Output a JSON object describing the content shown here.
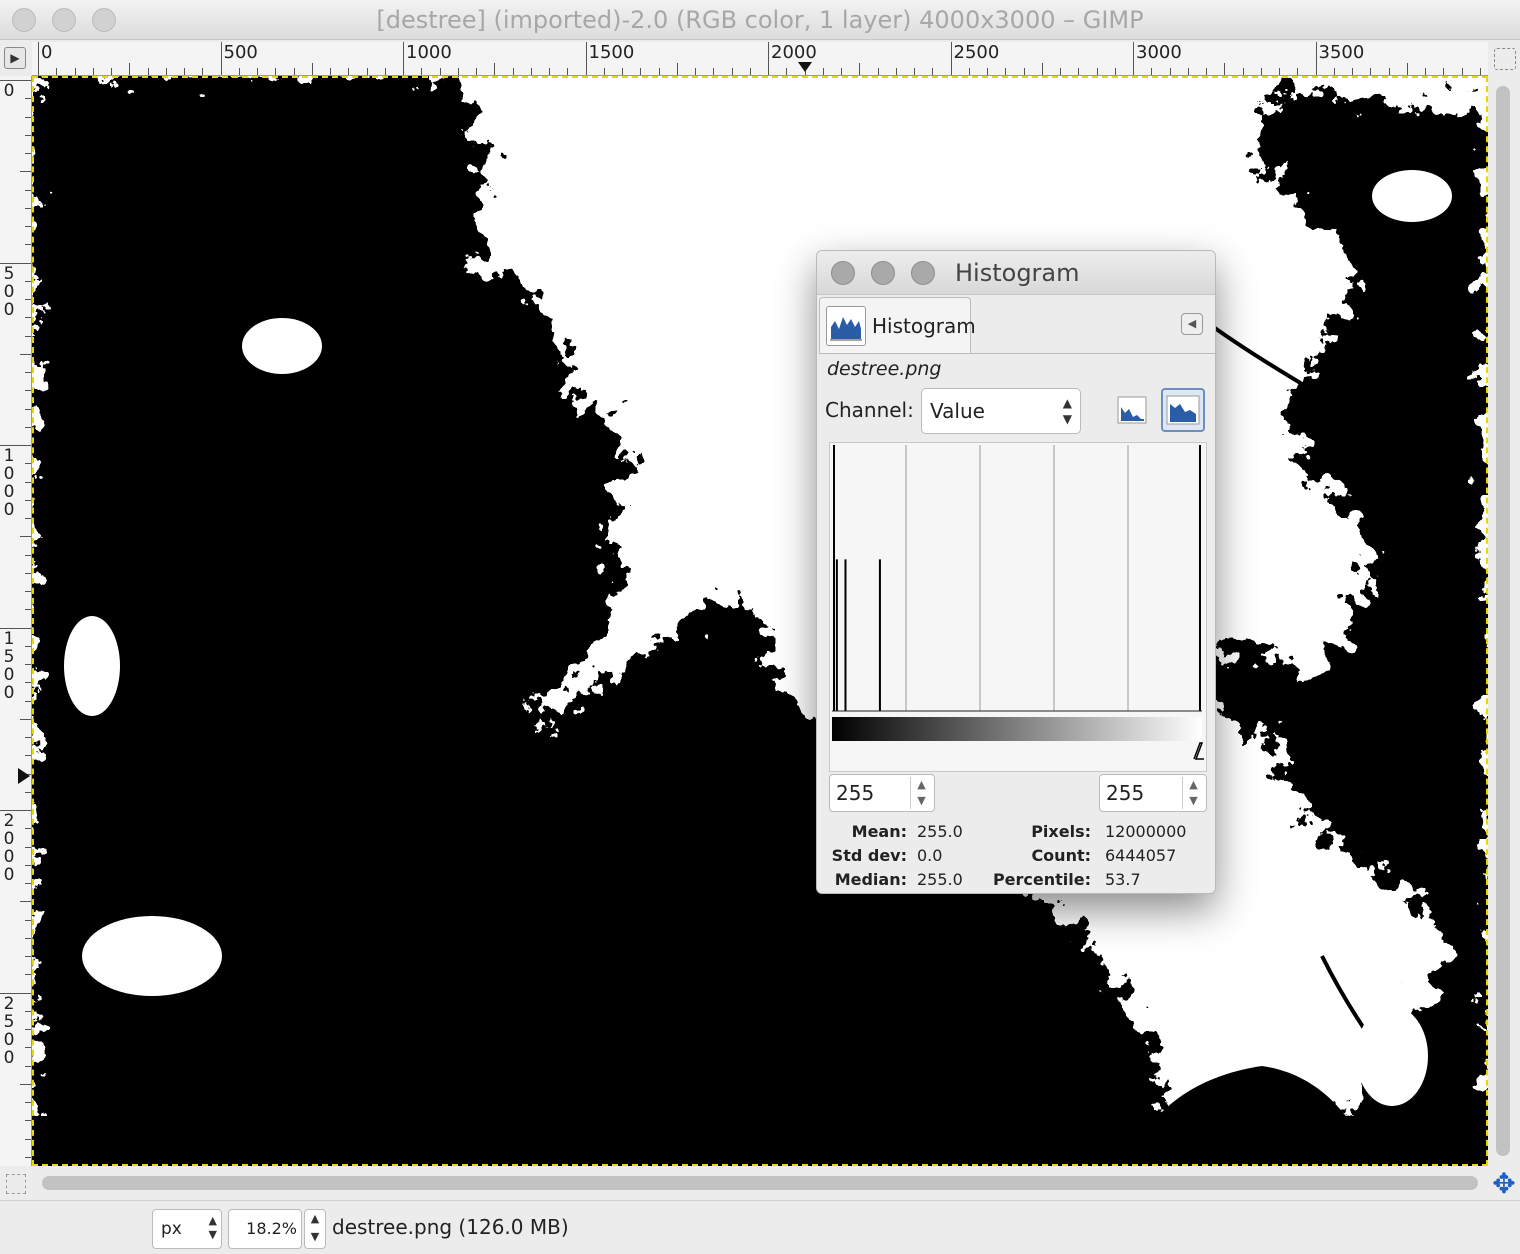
{
  "window": {
    "title": "[destree] (imported)-2.0 (RGB color, 1 layer) 4000x3000 – GIMP"
  },
  "ruler_h": {
    "labels": [
      "0",
      "500",
      "1000",
      "1500",
      "2000",
      "2500",
      "3000",
      "3500"
    ]
  },
  "ruler_v": {
    "labels": [
      "0",
      "500",
      "1000",
      "1500",
      "2000",
      "2500"
    ]
  },
  "statusbar": {
    "unit": "px",
    "zoom": "18.2%",
    "info": "destree.png (126.0 MB)"
  },
  "histogram_dialog": {
    "title": "Histogram",
    "tab_label": "Histogram",
    "image_name": "destree.png",
    "channel_label": "Channel:",
    "channel_value": "Value",
    "range_start": "255",
    "range_end": "255",
    "stats": {
      "mean_label": "Mean:",
      "mean": "255.0",
      "stddev_label": "Std dev:",
      "stddev": "0.0",
      "median_label": "Median:",
      "median": "255.0",
      "pixels_label": "Pixels:",
      "pixels": "12000000",
      "count_label": "Count:",
      "count": "6444057",
      "percentile_label": "Percentile:",
      "percentile": "53.7"
    },
    "log_mode_active": true
  },
  "chart_data": {
    "type": "bar",
    "description_values": "histogram spikes by value level (relative height 0-1)",
    "x": [
      0,
      2,
      8,
      32,
      255
    ],
    "values": [
      1.0,
      0.57,
      0.57,
      0.57,
      1.0
    ],
    "xlim": [
      0,
      255
    ],
    "ylim": [
      0,
      1
    ]
  },
  "colors": {
    "selection_border": "#e8d800",
    "accent_blue": "#1f5fbf"
  }
}
